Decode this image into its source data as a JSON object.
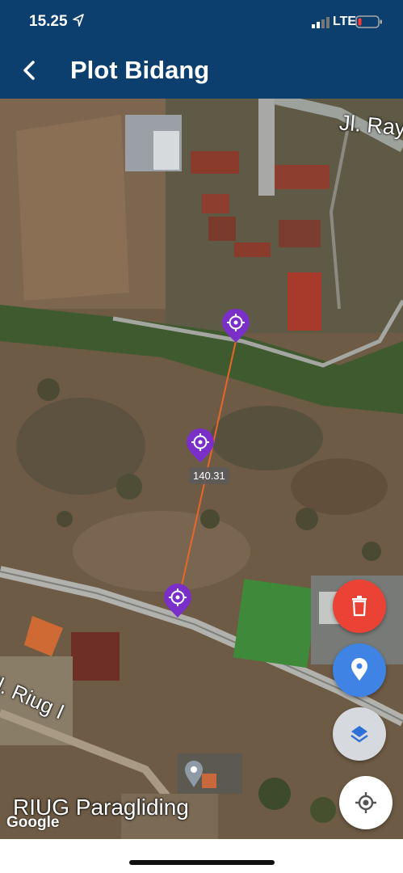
{
  "status_bar": {
    "time": "15.25",
    "network": "LTE"
  },
  "header": {
    "title": "Plot Bidang"
  },
  "map": {
    "road_labels": {
      "top_right": "Jl. Ray",
      "bottom_left": "Jl. Riug I"
    },
    "poi_label": "RIUG Paragliding",
    "attribution": "Google",
    "distance_label": "140.31",
    "line_color": "#e8662a",
    "marker_color": "#7a2fc9"
  },
  "fabs": {
    "delete": {
      "icon": "trash-icon",
      "color": "#ea4335"
    },
    "location": {
      "icon": "map-pin-icon",
      "color": "#3f84e5"
    },
    "layers": {
      "icon": "layers-icon",
      "color": "#d6d9dd"
    },
    "gps": {
      "icon": "crosshair-icon",
      "color": "#ffffff"
    }
  }
}
